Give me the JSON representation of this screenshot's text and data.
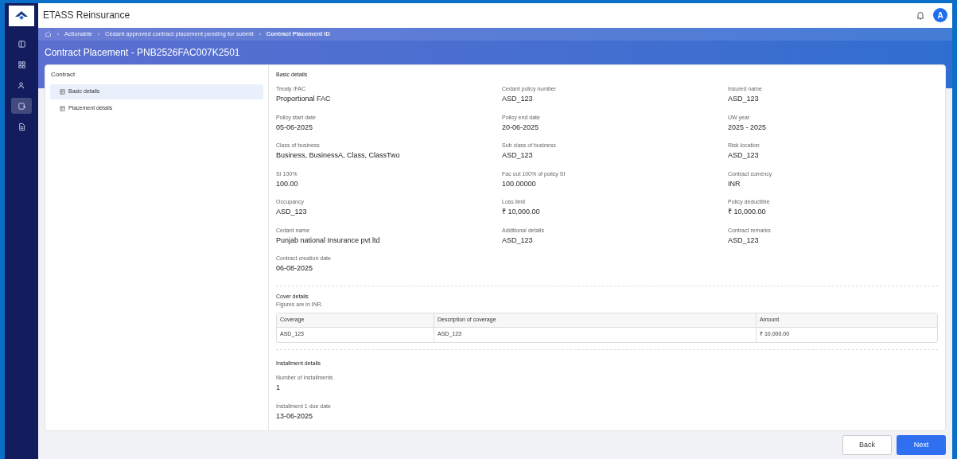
{
  "app": {
    "title": "ETASS Reinsurance",
    "avatar": "A"
  },
  "sidebar": {
    "items": [
      {
        "selected": false
      },
      {
        "selected": false
      },
      {
        "selected": false
      },
      {
        "selected": true
      },
      {
        "selected": false
      }
    ]
  },
  "breadcrumb": [
    "Actionable",
    "Cedant approved contract placement pending for submit",
    "Contract Placement ID"
  ],
  "page_title": "Contract Placement - PNB2526FAC007K2501",
  "nav": {
    "title": "Contract",
    "items": [
      {
        "label": "Basic details",
        "selected": true
      },
      {
        "label": "Placement details",
        "selected": false
      }
    ]
  },
  "basic_details": {
    "title": "Basic details",
    "fields": [
      {
        "label": "Treaty /FAC",
        "value": "Proportional FAC"
      },
      {
        "label": "Cedant policy number",
        "value": "ASD_123"
      },
      {
        "label": "Insured name",
        "value": "ASD_123"
      },
      {
        "label": "Policy start date",
        "value": "05-06-2025"
      },
      {
        "label": "Policy end date",
        "value": "20-06-2025"
      },
      {
        "label": "UW year",
        "value": "2025 - 2025"
      },
      {
        "label": "Class of business",
        "value": "Business, BusinessA, Class, ClassTwo"
      },
      {
        "label": "Sub class of business",
        "value": "ASD_123"
      },
      {
        "label": "Risk location",
        "value": "ASD_123"
      },
      {
        "label": "SI 100%",
        "value": "100.00"
      },
      {
        "label": "Fac out 100% of policy SI",
        "value": "100.00000"
      },
      {
        "label": "Contract currency",
        "value": "INR"
      },
      {
        "label": "Occupancy",
        "value": "ASD_123"
      },
      {
        "label": "Loss limit",
        "value": "₹ 10,000.00"
      },
      {
        "label": "Policy deductible",
        "value": "₹ 10,000.00"
      },
      {
        "label": "Cedant name",
        "value": "Punjab national Insurance pvt ltd"
      },
      {
        "label": "Additional details",
        "value": "ASD_123"
      },
      {
        "label": "Contract remarks",
        "value": "ASD_123"
      },
      {
        "label": "Contract creation date",
        "value": "06-08-2025"
      }
    ]
  },
  "cover_details": {
    "title": "Cover details",
    "note": "Figures are in INR.",
    "columns": [
      "Coverage",
      "Description of coverage",
      "Amount"
    ],
    "rows": [
      [
        "ASD_123",
        "ASD_123",
        "₹ 10,000.00"
      ]
    ]
  },
  "installment_details": {
    "title": "Installment details",
    "fields": [
      {
        "label": "Number of installments",
        "value": "1"
      },
      {
        "label": "Installment 1 due date",
        "value": "13-06-2025"
      }
    ]
  },
  "buttons": {
    "back": "Back",
    "next": "Next"
  }
}
